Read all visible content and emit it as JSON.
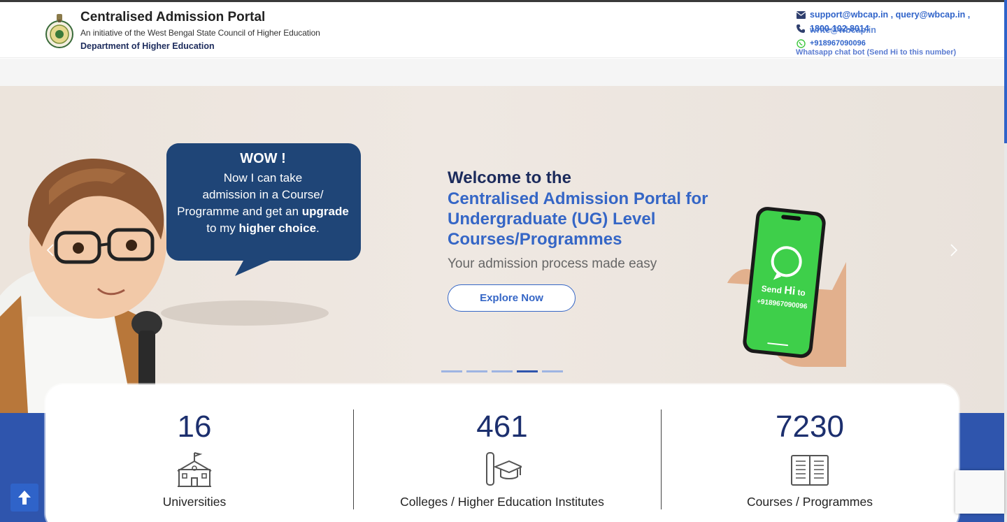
{
  "header": {
    "title": "Centralised Admission Portal",
    "subtitle": "An initiative of the West Bengal State Council of Higher Education",
    "department": "Department of Higher Education",
    "contact": {
      "emails": "support@wbcap.in , query@wbcap.in ,",
      "phone": "1800-102-8014",
      "email_overlap": "write@wbcap.in",
      "whatsapp": "+918967090096",
      "whatsapp_note": "Whatsapp chat bot (Send Hi to this number)"
    }
  },
  "hero": {
    "bubble": {
      "wow": "WOW !",
      "line1": "Now I can take",
      "line2": "admission in a Course/",
      "line3_pre": "Programme and get an ",
      "line3_bold": "upgrade",
      "line4_pre": "to my ",
      "line4_bold": "higher choice",
      "line4_post": "."
    },
    "welcome": "Welcome to the",
    "headline": "Centralised Admission Portal for Undergraduate (UG) Level Courses/Programmes",
    "tagline": "Your admission process made easy",
    "cta": "Explore Now",
    "phone_text": {
      "send": "Send",
      "hi": "Hi",
      "to": "to",
      "number": "+918967090096"
    },
    "slides_total": 5,
    "active_slide": 4
  },
  "stats": [
    {
      "value": "16",
      "label": "Universities",
      "icon": "university-building-icon"
    },
    {
      "value": "461",
      "label": "Colleges / Higher Education Institutes",
      "icon": "graduation-cap-scroll-icon"
    },
    {
      "value": "7230",
      "label": "Courses / Programmes",
      "icon": "open-book-icon"
    }
  ],
  "colors": {
    "primary": "#2f55ad",
    "accent": "#3566c6",
    "dark": "#1c2b5c",
    "whatsapp_green": "#3ec83e"
  }
}
